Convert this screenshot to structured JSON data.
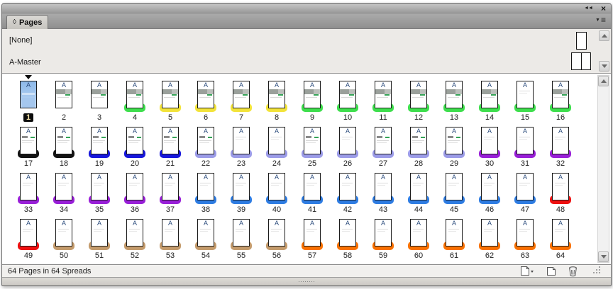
{
  "panel": {
    "title": "Pages"
  },
  "icons": {
    "tab_toggle": "◊",
    "collapse": "◄◄",
    "close": "×",
    "menu_arrow": "▼",
    "menu_lines": "≡"
  },
  "masters": [
    {
      "name": "[None]",
      "type": "single-page"
    },
    {
      "name": "A-Master",
      "type": "two-page-spread"
    }
  ],
  "statusbar": {
    "text": "64 Pages in 64 Spreads"
  },
  "colors": {
    "green": "#3ede4d",
    "yellow": "#f2e33a",
    "black": "#121212",
    "dark_blue": "#1717dc",
    "periwinkle": "#9c9ce8",
    "purple": "#991fd8",
    "blue": "#2e7ce2",
    "red": "#ee1010",
    "tan": "#c49b6c",
    "orange": "#f97102",
    "selected_fill": "#8db9ea"
  },
  "pages": [
    {
      "num": 1,
      "master": "A",
      "label": null,
      "thumb": "sel",
      "selected": true
    },
    {
      "num": 2,
      "master": "A",
      "label": null,
      "thumb": "photo",
      "selected": false
    },
    {
      "num": 3,
      "master": "A",
      "label": null,
      "thumb": "photo",
      "selected": false
    },
    {
      "num": 4,
      "master": "A",
      "label": "green",
      "thumb": "photo",
      "selected": false
    },
    {
      "num": 5,
      "master": "A",
      "label": "yellow",
      "thumb": "photo",
      "selected": false
    },
    {
      "num": 6,
      "master": "A",
      "label": "yellow",
      "thumb": "photo",
      "selected": false
    },
    {
      "num": 7,
      "master": "A",
      "label": "yellow",
      "thumb": "photo",
      "selected": false
    },
    {
      "num": 8,
      "master": "A",
      "label": "yellow",
      "thumb": "photo",
      "selected": false
    },
    {
      "num": 9,
      "master": "A",
      "label": "green",
      "thumb": "photo",
      "selected": false
    },
    {
      "num": 10,
      "master": "A",
      "label": "green",
      "thumb": "photo",
      "selected": false
    },
    {
      "num": 11,
      "master": "A",
      "label": "green",
      "thumb": "photo",
      "selected": false
    },
    {
      "num": 12,
      "master": "A",
      "label": "green",
      "thumb": "photo",
      "selected": false
    },
    {
      "num": 13,
      "master": "A",
      "label": "green",
      "thumb": "photo",
      "selected": false
    },
    {
      "num": 14,
      "master": "A",
      "label": "green",
      "thumb": "photo",
      "selected": false
    },
    {
      "num": 15,
      "master": "A",
      "label": "green",
      "thumb": "faint",
      "selected": false
    },
    {
      "num": 16,
      "master": "A",
      "label": "green",
      "thumb": "photo",
      "selected": false
    },
    {
      "num": 17,
      "master": "A",
      "label": "black",
      "thumb": "lines",
      "selected": false
    },
    {
      "num": 18,
      "master": "A",
      "label": "black",
      "thumb": "lines",
      "selected": false
    },
    {
      "num": 19,
      "master": "A",
      "label": "dark_blue",
      "thumb": "lines",
      "selected": false
    },
    {
      "num": 20,
      "master": "A",
      "label": "dark_blue",
      "thumb": "lines",
      "selected": false
    },
    {
      "num": 21,
      "master": "A",
      "label": "dark_blue",
      "thumb": "lines",
      "selected": false
    },
    {
      "num": 22,
      "master": "A",
      "label": "periwinkle",
      "thumb": "lines",
      "selected": false
    },
    {
      "num": 23,
      "master": "A",
      "label": "periwinkle",
      "thumb": "faint",
      "selected": false
    },
    {
      "num": 24,
      "master": "A",
      "label": "periwinkle",
      "thumb": "faint",
      "selected": false
    },
    {
      "num": 25,
      "master": "A",
      "label": "periwinkle",
      "thumb": "lines",
      "selected": false
    },
    {
      "num": 26,
      "master": "A",
      "label": "periwinkle",
      "thumb": "faint",
      "selected": false
    },
    {
      "num": 27,
      "master": "A",
      "label": "periwinkle",
      "thumb": "lines",
      "selected": false
    },
    {
      "num": 28,
      "master": "A",
      "label": "periwinkle",
      "thumb": "lines",
      "selected": false
    },
    {
      "num": 29,
      "master": "A",
      "label": "periwinkle",
      "thumb": "lines",
      "selected": false
    },
    {
      "num": 30,
      "master": "A",
      "label": "purple",
      "thumb": "faint",
      "selected": false
    },
    {
      "num": 31,
      "master": "A",
      "label": "purple",
      "thumb": "faint",
      "selected": false
    },
    {
      "num": 32,
      "master": "A",
      "label": "purple",
      "thumb": "faint",
      "selected": false
    },
    {
      "num": 33,
      "master": "A",
      "label": "purple",
      "thumb": "faint",
      "selected": false
    },
    {
      "num": 34,
      "master": "A",
      "label": "purple",
      "thumb": "faint",
      "selected": false
    },
    {
      "num": 35,
      "master": "A",
      "label": "purple",
      "thumb": "faint",
      "selected": false
    },
    {
      "num": 36,
      "master": "A",
      "label": "purple",
      "thumb": "faint",
      "selected": false
    },
    {
      "num": 37,
      "master": "A",
      "label": "purple",
      "thumb": "faint",
      "selected": false
    },
    {
      "num": 38,
      "master": "A",
      "label": "blue",
      "thumb": "faint",
      "selected": false
    },
    {
      "num": 39,
      "master": "A",
      "label": "blue",
      "thumb": "faint",
      "selected": false
    },
    {
      "num": 40,
      "master": "A",
      "label": "blue",
      "thumb": "faint",
      "selected": false
    },
    {
      "num": 41,
      "master": "A",
      "label": "blue",
      "thumb": "faint",
      "selected": false
    },
    {
      "num": 42,
      "master": "A",
      "label": "blue",
      "thumb": "faint",
      "selected": false
    },
    {
      "num": 43,
      "master": "A",
      "label": "blue",
      "thumb": "faint",
      "selected": false
    },
    {
      "num": 44,
      "master": "A",
      "label": "blue",
      "thumb": "faint",
      "selected": false
    },
    {
      "num": 45,
      "master": "A",
      "label": "blue",
      "thumb": "faint",
      "selected": false
    },
    {
      "num": 46,
      "master": "A",
      "label": "blue",
      "thumb": "faint",
      "selected": false
    },
    {
      "num": 47,
      "master": "A",
      "label": "blue",
      "thumb": "faint",
      "selected": false
    },
    {
      "num": 48,
      "master": "A",
      "label": "red",
      "thumb": "faint",
      "selected": false
    },
    {
      "num": 49,
      "master": "A",
      "label": "red",
      "thumb": "faint",
      "selected": false
    },
    {
      "num": 50,
      "master": "A",
      "label": "tan",
      "thumb": "faint",
      "selected": false
    },
    {
      "num": 51,
      "master": "A",
      "label": "tan",
      "thumb": "faint",
      "selected": false
    },
    {
      "num": 52,
      "master": "A",
      "label": "tan",
      "thumb": "faint",
      "selected": false
    },
    {
      "num": 53,
      "master": "A",
      "label": "tan",
      "thumb": "faint",
      "selected": false
    },
    {
      "num": 54,
      "master": "A",
      "label": "tan",
      "thumb": "faint",
      "selected": false
    },
    {
      "num": 55,
      "master": "A",
      "label": "tan",
      "thumb": "faint",
      "selected": false
    },
    {
      "num": 56,
      "master": "A",
      "label": "tan",
      "thumb": "faint",
      "selected": false
    },
    {
      "num": 57,
      "master": "A",
      "label": "orange",
      "thumb": "faint",
      "selected": false
    },
    {
      "num": 58,
      "master": "A",
      "label": "orange",
      "thumb": "faint",
      "selected": false
    },
    {
      "num": 59,
      "master": "A",
      "label": "orange",
      "thumb": "faint",
      "selected": false
    },
    {
      "num": 60,
      "master": "A",
      "label": "orange",
      "thumb": "faint",
      "selected": false
    },
    {
      "num": 61,
      "master": "A",
      "label": "orange",
      "thumb": "faint",
      "selected": false
    },
    {
      "num": 62,
      "master": "A",
      "label": "orange",
      "thumb": "faint",
      "selected": false
    },
    {
      "num": 63,
      "master": "A",
      "label": "orange",
      "thumb": "faint",
      "selected": false
    },
    {
      "num": 64,
      "master": "A",
      "label": "orange",
      "thumb": "faint",
      "selected": false
    }
  ]
}
